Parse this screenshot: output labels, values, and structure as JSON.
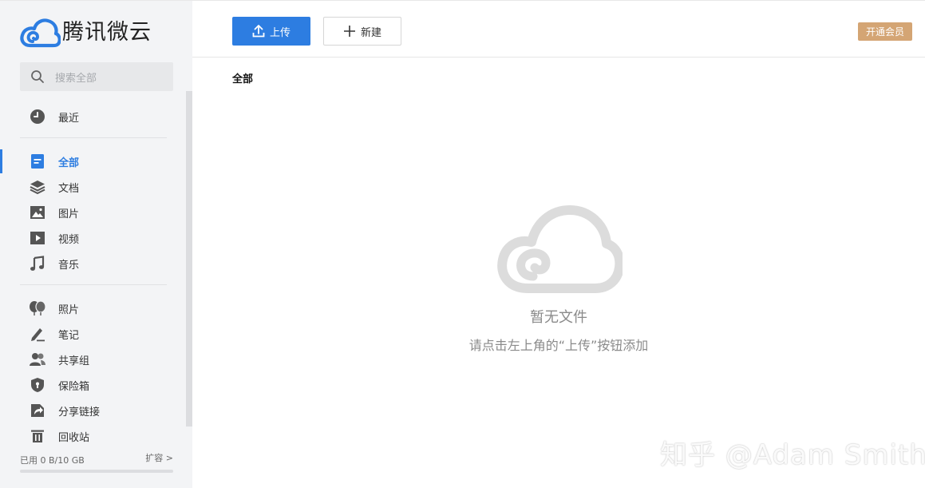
{
  "app": {
    "logo_text": "腾讯微云",
    "brand_color": "#2d7de1",
    "vip_color": "#d4a574"
  },
  "sidebar": {
    "search_placeholder": "搜索全部",
    "groups": [
      [
        {
          "label": "最近",
          "icon": "clock-icon",
          "active": false
        }
      ],
      [
        {
          "label": "全部",
          "icon": "document-icon",
          "active": true
        },
        {
          "label": "文档",
          "icon": "layers-icon",
          "active": false
        },
        {
          "label": "图片",
          "icon": "image-icon",
          "active": false
        },
        {
          "label": "视频",
          "icon": "play-icon",
          "active": false
        },
        {
          "label": "音乐",
          "icon": "music-icon",
          "active": false
        }
      ],
      [
        {
          "label": "照片",
          "icon": "balloons-icon",
          "active": false
        },
        {
          "label": "笔记",
          "icon": "pen-icon",
          "active": false
        },
        {
          "label": "共享组",
          "icon": "users-icon",
          "active": false
        },
        {
          "label": "保险箱",
          "icon": "shield-icon",
          "active": false
        },
        {
          "label": "分享链接",
          "icon": "share-icon",
          "active": false
        },
        {
          "label": "回收站",
          "icon": "trash-icon",
          "active": false
        }
      ]
    ],
    "storage": {
      "used_label": "已用 0 B/10 GB",
      "expand_label": "扩容 >",
      "used_fraction": 0
    }
  },
  "toolbar": {
    "upload_label": "上传",
    "new_label": "新建",
    "vip_label": "开通会员"
  },
  "breadcrumb": "全部",
  "empty_state": {
    "title": "暂无文件",
    "subtitle": "请点击左上角的“上传”按钮添加"
  },
  "watermark": "知乎 @Adam Smith"
}
